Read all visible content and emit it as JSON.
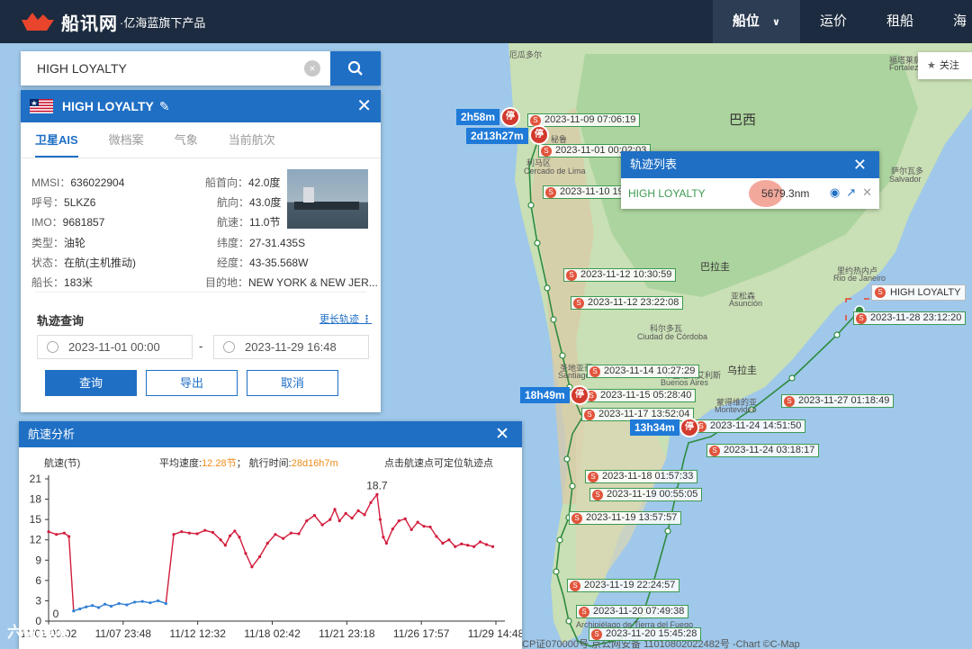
{
  "brand": {
    "name": "船讯网",
    "tagline": "·亿海蓝旗下产品"
  },
  "nav": [
    {
      "label": "船位",
      "active": true
    },
    {
      "label": "运价",
      "active": false
    },
    {
      "label": "租船",
      "active": false
    },
    {
      "label": "海",
      "active": false
    }
  ],
  "search": {
    "value": "HIGH LOYALTY",
    "clear": "×"
  },
  "ship": {
    "name": "HIGH LOYALTY",
    "close": "✕",
    "tabs": [
      "卫星AIS",
      "微档案",
      "气象",
      "当前航次"
    ],
    "fields_left": [
      {
        "k": "MMSI：",
        "v": "636022904"
      },
      {
        "k": "呼号：",
        "v": "5LKZ6"
      },
      {
        "k": "IMO：",
        "v": "9681857"
      },
      {
        "k": "类型：",
        "v": "油轮"
      },
      {
        "k": "状态：",
        "v": "在航(主机推动)"
      },
      {
        "k": "船长：",
        "v": "183米"
      }
    ],
    "fields_right": [
      {
        "k": "船首向：",
        "v": "42.0度"
      },
      {
        "k": "航向：",
        "v": "43.0度"
      },
      {
        "k": "航速：",
        "v": "11.0节"
      },
      {
        "k": "纬度：",
        "v": "27-31.435S"
      },
      {
        "k": "经度：",
        "v": "43-35.568W"
      },
      {
        "k": "目的地：",
        "v": "NEW YORK & NEW JER..."
      }
    ],
    "track_query": "轨迹查询",
    "more_tracks": "更长轨迹",
    "date_from": "2023-11-01 00:00",
    "date_sep": "-",
    "date_to": "2023-11-29 16:48",
    "btn_query": "查询",
    "btn_export": "导出",
    "btn_cancel": "取消"
  },
  "tracklist": {
    "title": "轨迹列表",
    "ship": "HIGH LOYALTY",
    "distance": "5679.3nm",
    "close": "✕"
  },
  "speed": {
    "title": "航速分析",
    "close": "✕",
    "unit_label": "航速(节)",
    "avg_label": "平均速度:",
    "avg_value": "12.28节",
    "time_label": "；  航行时间:",
    "time_value": "28d16h7m",
    "hint": "点击航速点可定位轨迹点"
  },
  "follow": "关注",
  "map_labels": {
    "countries": [
      "巴西",
      "巴拉圭",
      "乌拉圭"
    ],
    "cities": [
      "利马区",
      "Cercado de Lima",
      "亚松森",
      "Asunción",
      "科尔多瓦",
      "Ciudad de Córdoba",
      "圣地亚哥",
      "Santiago de Chile",
      "布宜诺斯艾利斯",
      "Buenos Aires",
      "蒙得维的亚",
      "Montevideo",
      "里约热内卢",
      "Rio de Janeiro",
      "萨尔瓦多",
      "Salvador",
      "福塔莱萨",
      "Fortaleza",
      "Archipiélago de Tierra del Fuego",
      "厄瓜多尔",
      "秘鲁"
    ],
    "durations": [
      "2h58m",
      "2d13h27m",
      "18h49m",
      "13h34m"
    ],
    "stop": "停",
    "stamp_icon": "S",
    "timestamps": [
      "2023-11-09 07:06:19",
      "2023-11-01 00:02:03",
      "2023-11-10 19",
      "2023-11-12 10:30:59",
      "2023-11-12 23:22:08",
      "2023-11-14 10:27:29",
      "2023-11-15 05:28:40",
      "2023-11-17 13:52:04",
      "2023-11-24 14:51:50",
      "2023-11-24 03:18:17",
      "2023-11-27 01:18:49",
      "2023-11-28 23:12:20",
      "2023-11-18 01:57:33",
      "2023-11-19 00:55:05",
      "2023-11-19 13:57:57",
      "2023-11-19 22:24:57",
      "2023-11-20 07:49:38",
      "2023-11-20 15:45:28"
    ],
    "ship_tag": "HIGH LOYALTY"
  },
  "footer": "CP证070000号  京公网安备 11010802022482号  -Chart ©C-Map",
  "watermark": "六数跨境",
  "colors": {
    "brand_blue": "#1f6fc5",
    "nav_bg": "#1c2b3f",
    "track_green": "#2e8b3e",
    "speed_red": "#d21c3c",
    "speed_blue": "#2f7fd4",
    "accent_orange": "#f08c1a"
  },
  "chart_data": {
    "type": "line",
    "title": "",
    "ylabel": "航速(节)",
    "xlabel": "",
    "ylim": [
      0,
      21
    ],
    "yticks": [
      0,
      3,
      6,
      9,
      12,
      15,
      18,
      21
    ],
    "xtick_labels": [
      "11/01 00:02",
      "11/07 23:48",
      "11/12 12:32",
      "11/18 02:42",
      "11/21 23:18",
      "11/26 17:57",
      "11/29 14:48"
    ],
    "annotations": [
      {
        "label": "18.7",
        "x": "11/21 23:18",
        "y": 18.7
      },
      {
        "label": "0",
        "x": "11/01 00:02",
        "y": 0
      }
    ],
    "series": [
      {
        "x_days": [
          0,
          0.5,
          1.0,
          1.3,
          1.6,
          2.0,
          2.4,
          2.8,
          3.2,
          3.6,
          4.0,
          4.5,
          5.0,
          5.5,
          6.0,
          6.5,
          7.0,
          7.5,
          8.0,
          8.5,
          9.0,
          9.5,
          10.0,
          10.5,
          11.0,
          11.3,
          11.6,
          11.9,
          12.2,
          12.6,
          13.0,
          13.5,
          14.0,
          14.5,
          15.0,
          15.5,
          16.0,
          16.5,
          17.0,
          17.5,
          18.0,
          18.3,
          18.6,
          19.0,
          19.4,
          19.8,
          20.2,
          20.6,
          21.0,
          21.2,
          21.4,
          21.6,
          22.0,
          22.4,
          22.8,
          23.2,
          23.6,
          24.0,
          24.4,
          24.8,
          25.2,
          25.6,
          26.0,
          26.4,
          26.8,
          27.2,
          27.6,
          28.0,
          28.4
        ],
        "speeds": [
          13.2,
          12.8,
          13.0,
          12.5,
          1.5,
          1.8,
          2.1,
          2.3,
          2.0,
          2.5,
          2.2,
          2.6,
          2.4,
          2.8,
          2.9,
          2.7,
          3.0,
          2.6,
          12.8,
          13.2,
          13.0,
          12.9,
          13.4,
          13.1,
          12.0,
          11.2,
          12.6,
          13.3,
          12.4,
          10.0,
          8.0,
          9.5,
          11.5,
          12.8,
          12.2,
          13.0,
          12.9,
          14.8,
          15.6,
          14.2,
          15.0,
          16.5,
          14.8,
          15.9,
          15.2,
          16.3,
          15.7,
          17.5,
          18.7,
          15.0,
          12.4,
          11.5,
          13.6,
          14.8,
          15.1,
          13.5,
          14.6,
          14.0,
          13.9,
          12.5,
          11.5,
          12.0,
          11.0,
          11.4,
          11.2,
          11.0,
          11.7,
          11.3,
          11.0
        ]
      }
    ]
  }
}
